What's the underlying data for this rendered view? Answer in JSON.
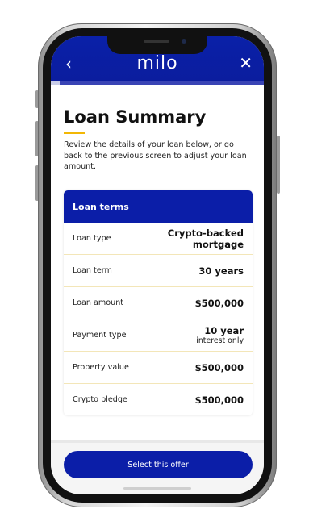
{
  "header": {
    "back_icon": "chevron-left-icon",
    "logo": "milo",
    "close_icon": "close-icon",
    "progress": 0.04
  },
  "summary": {
    "title": "Loan Summary",
    "intro": "Review the details of your loan below, or go back to the previous screen to adjust your loan amount."
  },
  "terms": {
    "heading": "Loan terms",
    "rows": [
      {
        "label": "Loan type",
        "value": "Crypto-backed mortgage",
        "sub": ""
      },
      {
        "label": "Loan term",
        "value": "30 years",
        "sub": ""
      },
      {
        "label": "Loan amount",
        "value": "$500,000",
        "sub": ""
      },
      {
        "label": "Payment type",
        "value": "10 year",
        "sub": "interest only"
      },
      {
        "label": "Property value",
        "value": "$500,000",
        "sub": ""
      },
      {
        "label": "Crypto pledge",
        "value": "$500,000",
        "sub": ""
      }
    ]
  },
  "footer": {
    "cta_label": "Select this offer"
  },
  "colors": {
    "brand_blue": "#0b1ea8",
    "accent_yellow": "#f2b705"
  }
}
